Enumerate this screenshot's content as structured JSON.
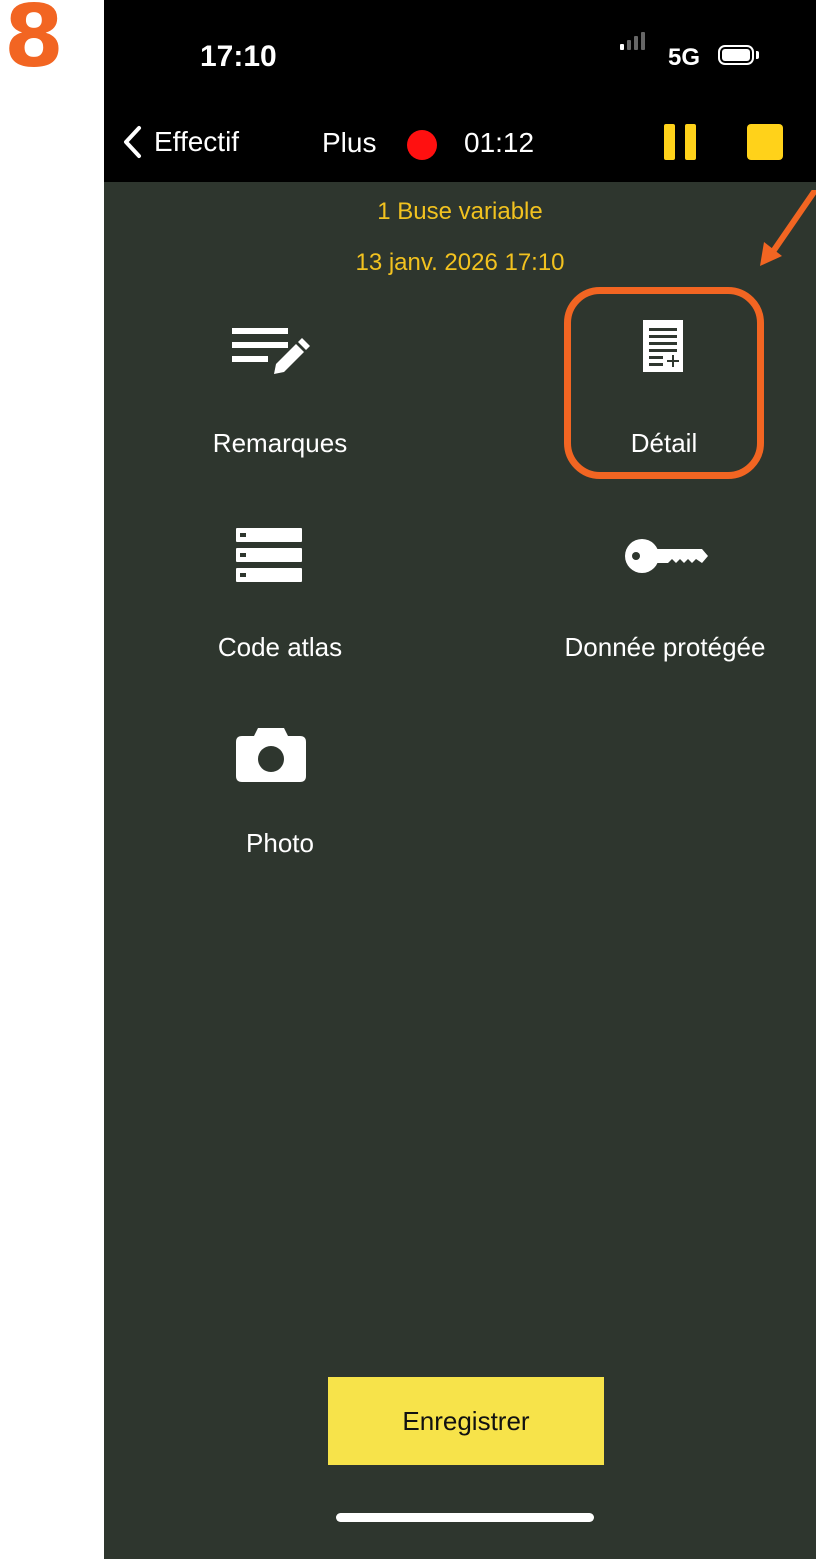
{
  "step": "8",
  "status_bar": {
    "time": "17:10",
    "network": "5G"
  },
  "nav": {
    "back_label": "Effectif",
    "more_label": "Plus",
    "recording_time": "01:12"
  },
  "observation": {
    "species": "1 Buse variable",
    "datetime": "13 janv. 2026 17:10"
  },
  "actions": [
    {
      "label": "Remarques",
      "icon": "notes-edit-icon"
    },
    {
      "label": "Détail",
      "icon": "document-add-icon"
    },
    {
      "label": "Code atlas",
      "icon": "list-icon"
    },
    {
      "label": "Donnée protégée",
      "icon": "key-icon"
    },
    {
      "label": "Photo",
      "icon": "camera-icon"
    }
  ],
  "save_label": "Enregistrer",
  "colors": {
    "accent": "#f2c21f",
    "annotation": "#f26522",
    "background": "#2e362e",
    "button": "#f7e34a",
    "record": "#ff1010"
  }
}
